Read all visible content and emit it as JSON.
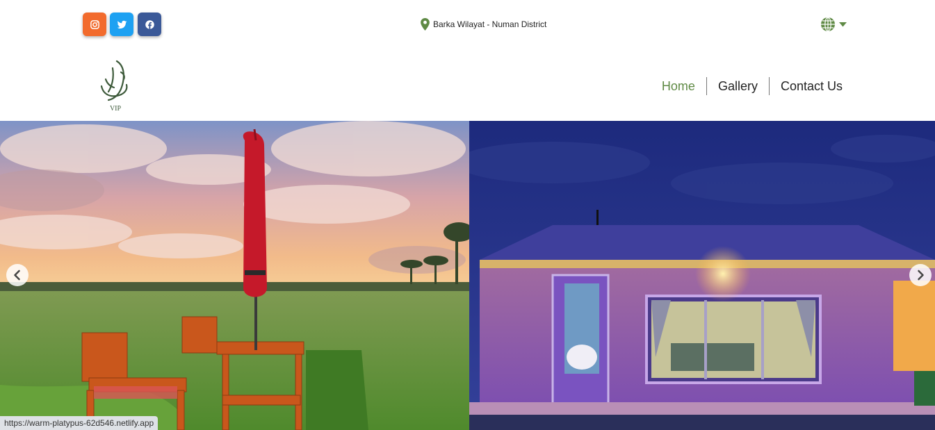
{
  "topbar": {
    "social": [
      {
        "icon": "instagram-icon",
        "color": "#f26b2d"
      },
      {
        "icon": "twitter-icon",
        "color": "#1da1f2"
      },
      {
        "icon": "facebook-icon",
        "color": "#3b5998"
      }
    ],
    "location": {
      "icon": "map-pin-icon",
      "text": "Barka Wilayat - Numan District"
    },
    "language": {
      "icon": "globe-icon",
      "caret": "caret-down-icon"
    }
  },
  "navbar": {
    "logo": {
      "script": "البندر",
      "text": "VIP"
    },
    "links": [
      {
        "label": "Home",
        "active": true
      },
      {
        "label": "Gallery",
        "active": false
      },
      {
        "label": "Contact Us",
        "active": false
      }
    ],
    "accent_color": "#5f8a45"
  },
  "hero": {
    "prev_icon": "chevron-left-icon",
    "next_icon": "chevron-right-icon"
  },
  "status_bar": {
    "url": "https://warm-platypus-62d546.netlify.app"
  }
}
